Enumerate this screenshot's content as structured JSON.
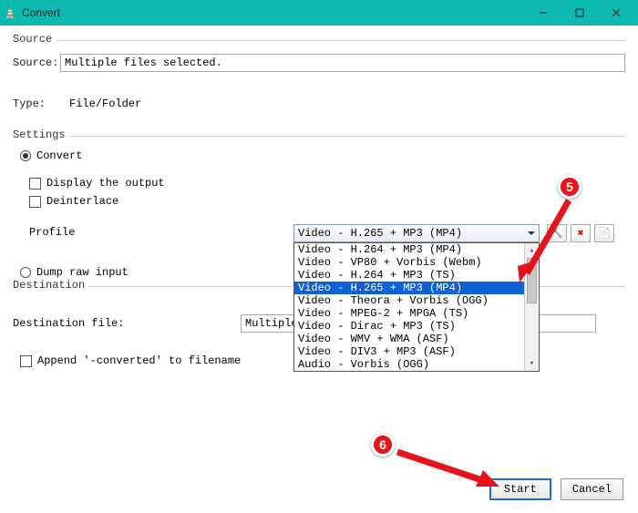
{
  "titlebar": {
    "title": "Convert"
  },
  "source": {
    "legend": "Source",
    "source_label": "Source:",
    "source_value": "Multiple files selected.",
    "type_label": "Type:",
    "type_value": "File/Folder"
  },
  "settings": {
    "legend": "Settings",
    "convert_label": "Convert",
    "display_output_label": "Display the output",
    "deinterlace_label": "Deinterlace",
    "profile_label": "Profile",
    "profile_selected": "Video - H.265 + MP3 (MP4)",
    "profile_options": [
      "Video - H.264 + MP3 (MP4)",
      "Video - VP80 + Vorbis (Webm)",
      "Video - H.264 + MP3 (TS)",
      "Video - H.265 + MP3 (MP4)",
      "Video - Theora + Vorbis (OGG)",
      "Video - MPEG-2 + MPGA (TS)",
      "Video - Dirac + MP3 (TS)",
      "Video - WMV + WMA (ASF)",
      "Video - DIV3 + MP3 (ASF)",
      "Audio - Vorbis (OGG)"
    ],
    "dump_label": "Dump raw input"
  },
  "destination": {
    "legend": "Destination",
    "file_label": "Destination file:",
    "file_value": "Multiple Fil",
    "append_label": "Append '-converted' to filename"
  },
  "footer": {
    "start": "Start",
    "cancel": "Cancel"
  },
  "annotations": {
    "b5": "5",
    "b6": "6"
  },
  "icons": {
    "wrench": "🔧",
    "delete": "✖",
    "save": "📄"
  }
}
